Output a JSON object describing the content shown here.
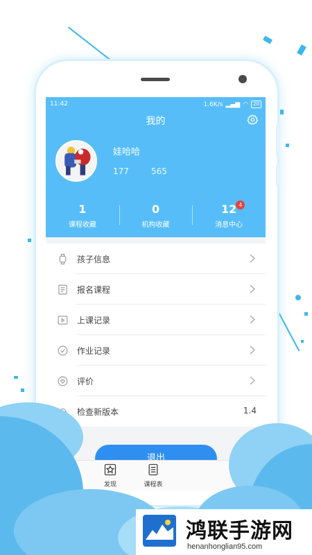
{
  "status_bar": {
    "time": "11:42",
    "speed": "1.6K/s",
    "battery": "20"
  },
  "header": {
    "title": "我的"
  },
  "profile": {
    "name": "娃哈哈",
    "stat_a": "177",
    "stat_b": "565"
  },
  "counts": [
    {
      "value": "1",
      "label": "课程收藏"
    },
    {
      "value": "0",
      "label": "机构收藏"
    },
    {
      "value": "12",
      "label": "消息中心",
      "badge": "4"
    }
  ],
  "menu": [
    {
      "label": "孩子信息",
      "icon": "child-watch-icon"
    },
    {
      "label": "报名课程",
      "icon": "enroll-doc-icon"
    },
    {
      "label": "上课记录",
      "icon": "class-record-icon"
    },
    {
      "label": "作业记录",
      "icon": "homework-icon"
    },
    {
      "label": "评价",
      "icon": "review-heart-icon"
    },
    {
      "label": "检查新版本",
      "icon": "cloud-upload-icon",
      "value": "1.4"
    }
  ],
  "logout_label": "退出",
  "tabbar": [
    {
      "label": "",
      "icon": "home-icon"
    },
    {
      "label": "发现",
      "icon": "discover-star-icon"
    },
    {
      "label": "课程表",
      "icon": "schedule-icon"
    }
  ],
  "watermark": {
    "name": "鸿联手游网",
    "url": "henanhonglian95.com"
  },
  "colors": {
    "header_blue": "#56bdf8",
    "button_blue": "#2f8ff0",
    "badge_red": "#e8413b",
    "cloud_blue": "#7cc8f3"
  }
}
